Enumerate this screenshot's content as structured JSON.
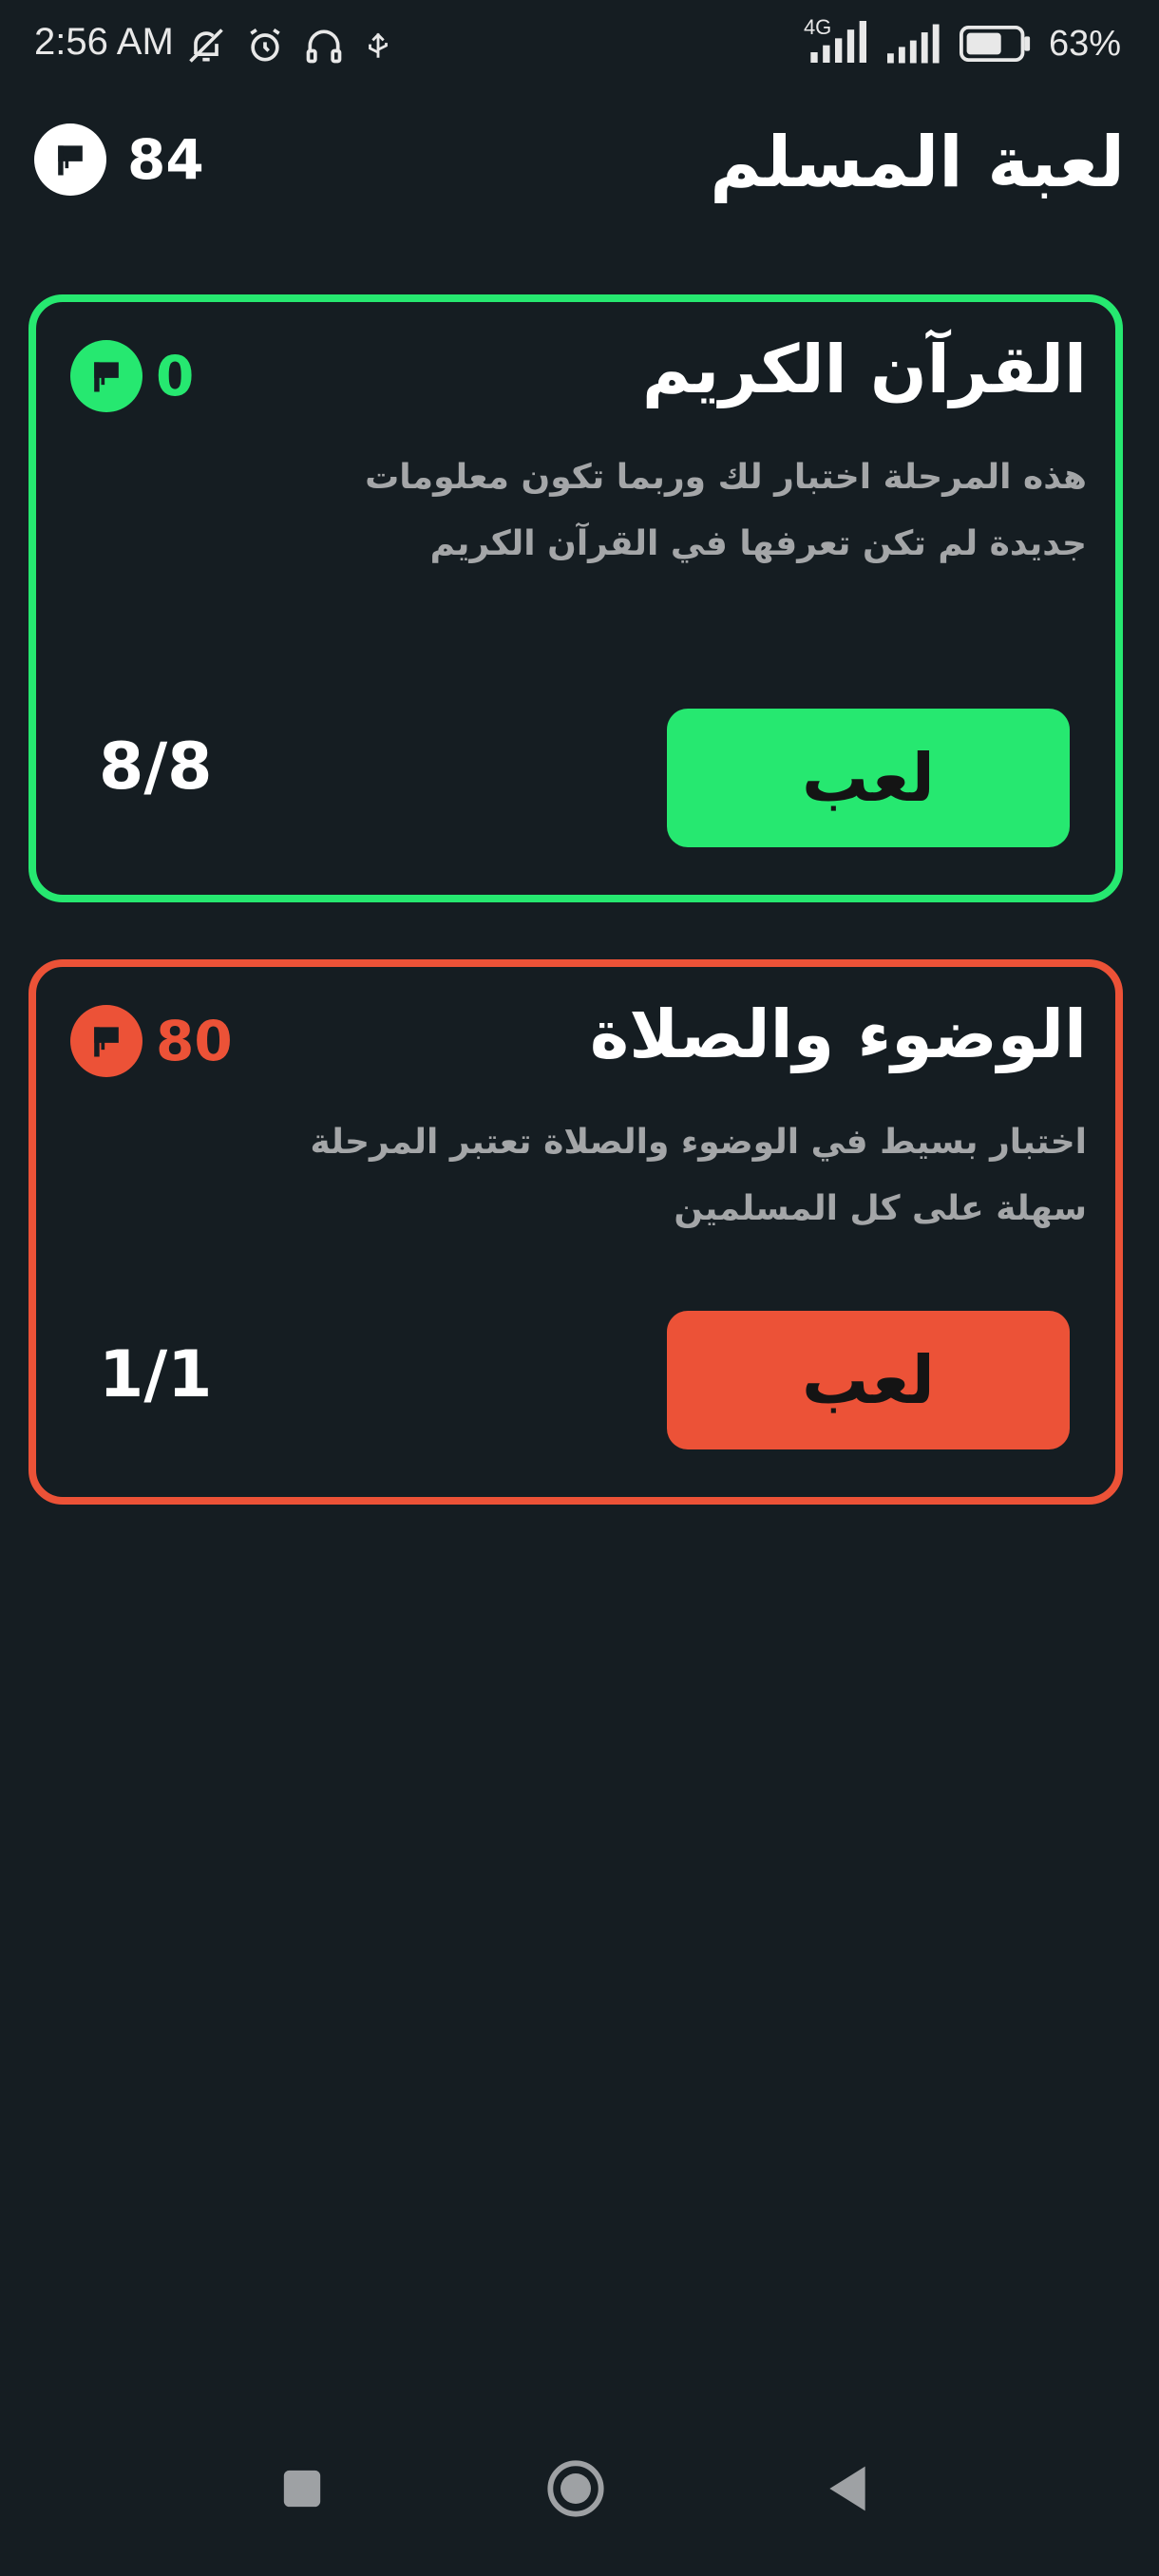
{
  "status_bar": {
    "time": "2:56 AM",
    "network": "4G",
    "battery": "63%",
    "icons": [
      "mute-bell-icon",
      "alarm-icon",
      "headset-icon",
      "usb-icon",
      "signal-icon",
      "battery-icon"
    ]
  },
  "header": {
    "title": "لعبة المسلم",
    "total_score": "84",
    "score_icon": "flag-icon"
  },
  "colors": {
    "background": "#151d22",
    "green": "#26e870",
    "red": "#ec5237",
    "text_muted": "#a4a6a8"
  },
  "levels": [
    {
      "title": "القرآن الكريم",
      "description": "هذه المرحلة اختبار لك وربما تكون معلومات جديدة لم تكن تعرفها في القرآن الكريم",
      "score": "0",
      "button_label": "لعب",
      "progress": "8/8",
      "color": "#26e870"
    },
    {
      "title": "الوضوء والصلاة",
      "description": "اختبار بسيط في الوضوء والصلاة تعتبر المرحلة سهلة على كل المسلمين",
      "score": "80",
      "button_label": "لعب",
      "progress": "1/1",
      "color": "#ec5237"
    }
  ],
  "nav_bar": {
    "buttons": [
      "recents-icon",
      "home-icon",
      "back-icon"
    ]
  }
}
